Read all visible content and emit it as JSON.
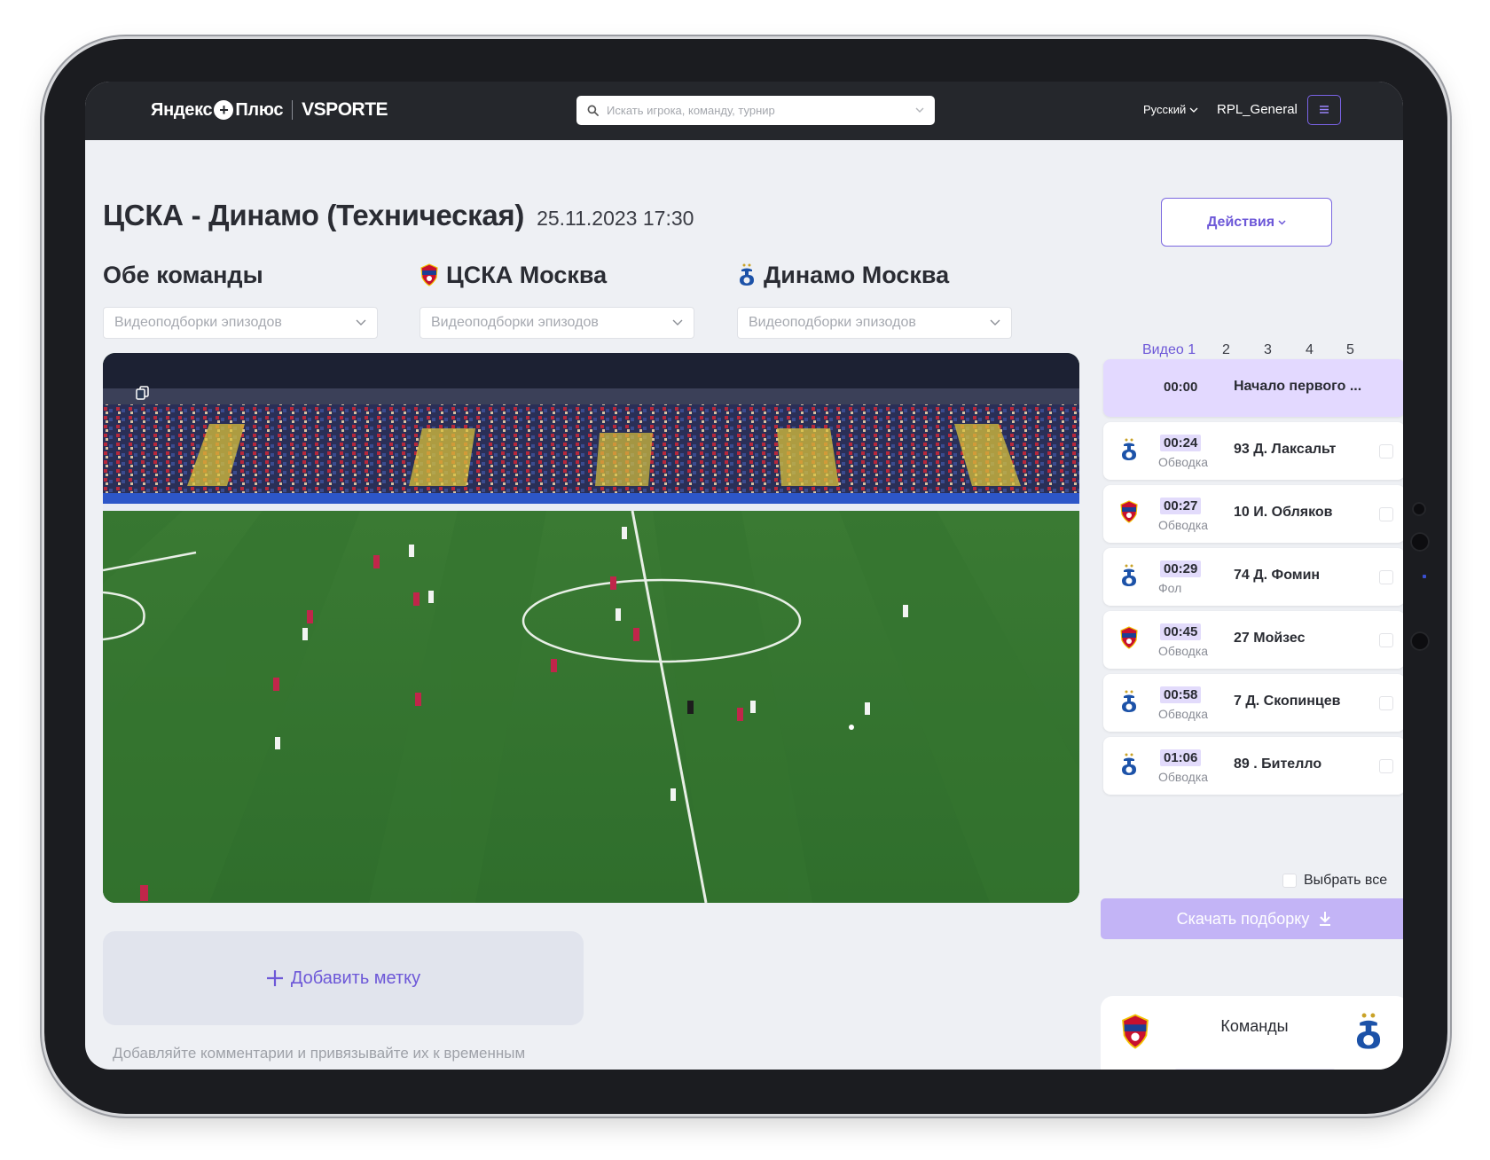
{
  "header": {
    "logo_yandex": "Яндекс",
    "logo_plus_glyph": "+",
    "logo_plus": "Плюс",
    "logo_vsporte": "VSPORTE",
    "search_placeholder": "Искать игрока, команду, турнир",
    "language": "Русский",
    "username": "RPL_General"
  },
  "match": {
    "title": "ЦСКА - Динамо (Техническая)",
    "datetime": "25.11.2023 17:30",
    "actions_label": "Действия"
  },
  "teams": {
    "both": {
      "name": "Обе команды",
      "dropdown_placeholder": "Видеоподборки эпизодов"
    },
    "home": {
      "name": "ЦСКА Москва",
      "dropdown_placeholder": "Видеоподборки эпизодов"
    },
    "away": {
      "name": "Динамо Москва",
      "dropdown_placeholder": "Видеоподборки эпизодов"
    }
  },
  "video_tabs": [
    "Видео 1",
    "2",
    "3",
    "4",
    "5"
  ],
  "episodes": [
    {
      "time": "00:00",
      "type": "",
      "name": "Начало первого ...",
      "team": "none",
      "highlight": true
    },
    {
      "time": "00:24",
      "type": "Обводка",
      "name": "93 Д. Лаксальт",
      "team": "dinamo"
    },
    {
      "time": "00:27",
      "type": "Обводка",
      "name": "10 И. Обляков",
      "team": "cska"
    },
    {
      "time": "00:29",
      "type": "Фол",
      "name": "74 Д. Фомин",
      "team": "dinamo"
    },
    {
      "time": "00:45",
      "type": "Обводка",
      "name": "27 Мойзес",
      "team": "cska"
    },
    {
      "time": "00:58",
      "type": "Обводка",
      "name": "7 Д. Скопинцев",
      "team": "dinamo"
    },
    {
      "time": "01:06",
      "type": "Обводка",
      "name": "89 . Бителло",
      "team": "dinamo"
    }
  ],
  "select_all_label": "Выбрать все",
  "download_label": "Скачать подборку",
  "add_mark_label": "Добавить метку",
  "hint_text": "Добавляйте комментарии и привязывайте их к временным",
  "teams_card_label": "Команды",
  "colors": {
    "accent": "#6d58d8",
    "header_bg": "#25272c",
    "screen_bg": "#eef0f4",
    "download_bg": "#c3b4f6",
    "highlight_bg": "#e3d9ff"
  }
}
